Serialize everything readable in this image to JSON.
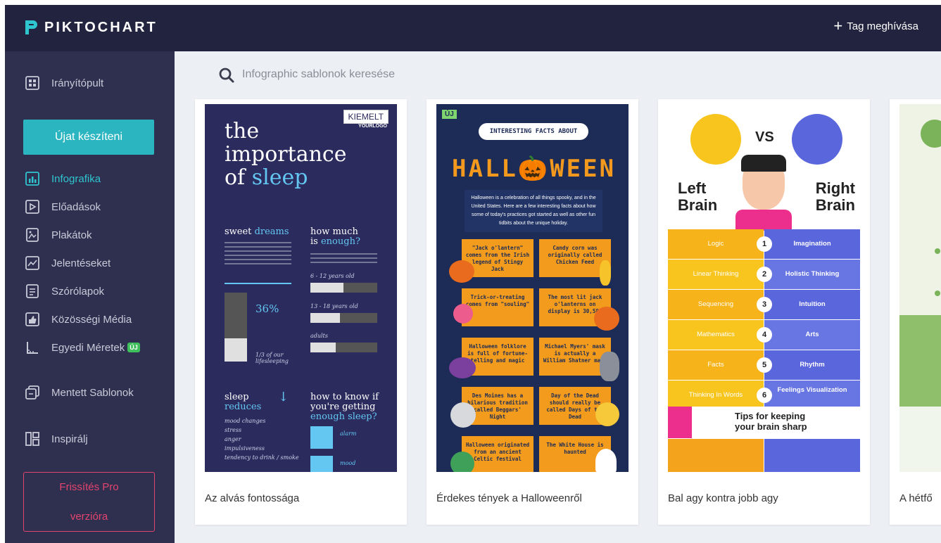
{
  "app": {
    "brand": "PIKTOCHART",
    "invite_label": "Tag meghívása"
  },
  "sidebar": {
    "dashboard": "Irányítópult",
    "create_button": "Újat készíteni",
    "items": [
      {
        "label": "Infografika",
        "icon": "infographic-icon",
        "active": true
      },
      {
        "label": "Előadások",
        "icon": "presentation-icon"
      },
      {
        "label": "Plakátok",
        "icon": "poster-icon"
      },
      {
        "label": "Jelentéseket",
        "icon": "report-icon"
      },
      {
        "label": "Szórólapok",
        "icon": "flyer-icon"
      },
      {
        "label": "Közösségi Média",
        "icon": "social-media-icon"
      },
      {
        "label": "Egyedi Méretek",
        "icon": "custom-size-icon",
        "badge": "ÚJ"
      }
    ],
    "saved_templates": "Mentett Sablonok",
    "inspire": "Inspirálj",
    "upgrade_line1": "Frissítés Pro",
    "upgrade_line2": "verzióra",
    "active_color": "#2fc5cf",
    "upgrade_color": "#e2446d"
  },
  "search": {
    "placeholder": "Infographic sablonok keresése"
  },
  "cards": [
    {
      "title": "Az alvás fontossága",
      "badge": "KIEMELT",
      "thumb": {
        "logo": "YOURLOGO",
        "h1": "the",
        "h2": "importance",
        "h3": "of",
        "h3b": "sleep",
        "s1a": "sweet",
        "s1b": "dreams",
        "s2a": "how much",
        "s2b": "is",
        "s2c": "enough?",
        "pct": "36%",
        "ratio": "1/3 of our lifesleeping",
        "age1": "6 - 12 years old",
        "age2": "13 - 18 years old",
        "age3": "adults",
        "s3a": "sleep",
        "s3b": "reduces",
        "s4a": "how to know if",
        "s4b": "you're getting",
        "s4c": "enough sleep?",
        "list": [
          "mood changes",
          "stress",
          "anger",
          "impulsiveness",
          "tendency to drink / smoke"
        ],
        "alarm": "alarm",
        "mood": "mood"
      }
    },
    {
      "title": "Érdekes tények a Halloweenről",
      "badge": "ÚJ",
      "thumb": {
        "pill": "INTERESTING FACTS ABOUT",
        "big": "HALL🎃WEEN",
        "intro": "Halloween is a celebration of all things spooky, and in the United States. Here are a few interesting facts about how some of today's practices got started as well as other fun tidbits about the unique holiday.",
        "facts": [
          "\"Jack o'lantern\" comes from the Irish legend of Stingy Jack",
          "Candy corn was originally called Chicken Feed",
          "Trick-or-treating comes from \"souling\"",
          "The most lit jack o'lanterns on display is 30,581",
          "Halloween folklore is full of fortune-telling and magic",
          "Michael Myers' mask is actually a William Shatner mask",
          "Des Moines has a hilarious tradition called Beggars' Night",
          "Day of the Dead should really be called Days of the Dead",
          "Halloween originated from an ancient Celtic festival",
          "The White House is haunted"
        ]
      }
    },
    {
      "title": "Bal agy kontra jobb agy",
      "thumb": {
        "vs": "VS",
        "left": "Left Brain",
        "right": "Right Brain",
        "rows": [
          {
            "n": "1",
            "l": "Logic",
            "r": "Imagination"
          },
          {
            "n": "2",
            "l": "Linear Thinking",
            "r": "Holistic Thinking"
          },
          {
            "n": "3",
            "l": "Sequencing",
            "r": "Intuition"
          },
          {
            "n": "4",
            "l": "Mathematics",
            "r": "Arts"
          },
          {
            "n": "5",
            "l": "Facts",
            "r": "Rhythm"
          },
          {
            "n": "6",
            "l": "Thinking In Words",
            "r": "Feelings Visualization"
          }
        ],
        "tips1": "Tips for keeping",
        "tips2": "your brain sharp"
      }
    },
    {
      "title": "A hétfő"
    }
  ]
}
